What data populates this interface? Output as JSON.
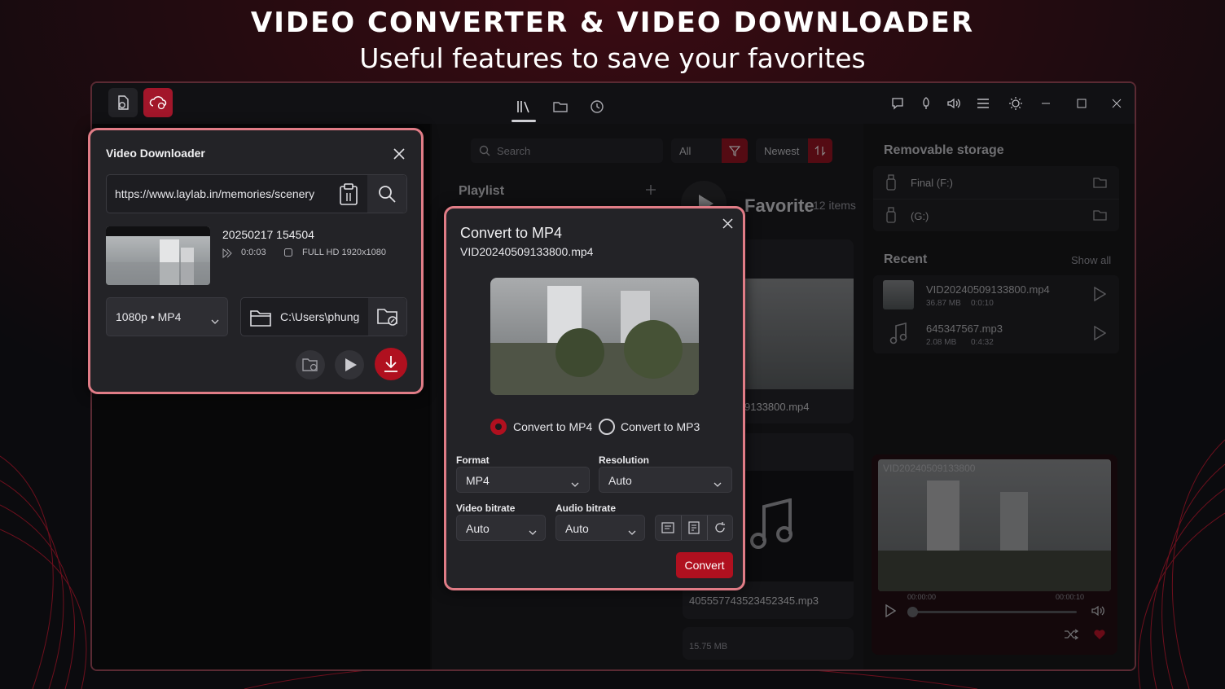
{
  "promo": {
    "title": "VIDEO CONVERTER & VIDEO DOWNLOADER",
    "subtitle": "Useful features to save your favorites"
  },
  "colors": {
    "accent": "#b0101f",
    "highlight_border": "#e07c86",
    "background": "#0b0b0e"
  },
  "titlebar": {
    "left_icons": [
      "file-convert-icon",
      "cloud-download-icon"
    ],
    "tab_icons": [
      "library-icon",
      "folder-icon",
      "history-icon"
    ],
    "right_icons": [
      "chat-icon",
      "rocket-icon",
      "volume-icon",
      "menu-icon",
      "theme-icon",
      "minimize-icon",
      "maximize-icon",
      "close-icon"
    ]
  },
  "library": {
    "search_placeholder": "Search",
    "filter_value": "All",
    "sort_value": "Newest",
    "playlist_label": "Playlist",
    "favorite_title": "Favorite",
    "favorite_count": "12 items",
    "card1_name": "9133800.mp4",
    "card2_name": "405557743523452345.mp3",
    "card3_size": "15.75 MB"
  },
  "sidebar": {
    "removable_title": "Removable storage",
    "drives": [
      {
        "label": "Final (F:)"
      },
      {
        "label": "(G:)"
      }
    ],
    "recent_title": "Recent",
    "show_all": "Show all",
    "recent": [
      {
        "name": "VID20240509133800.mp4",
        "size": "36.87 MB",
        "duration": "0:0:10"
      },
      {
        "name": "645347567.mp3",
        "size": "2.08 MB",
        "duration": "0:4:32"
      }
    ],
    "player": {
      "overlay_title": "VID20240509133800",
      "time_current": "00:00:00",
      "time_total": "00:00:10",
      "progress": 0.0
    }
  },
  "downloader": {
    "title": "Video Downloader",
    "url": "https://www.laylab.in/memories/scenery",
    "video_title": "20250217 154504",
    "duration": "0:0:03",
    "quality": "FULL HD 1920x1080",
    "format_selected": "1080p • MP4",
    "save_path": "C:\\Users\\phung"
  },
  "converter": {
    "title": "Convert to MP4",
    "filename": "VID20240509133800.mp4",
    "radio_mp4": "Convert to MP4",
    "radio_mp3": "Convert to MP3",
    "selected": "mp4",
    "format_label": "Format",
    "format_value": "MP4",
    "resolution_label": "Resolution",
    "resolution_value": "Auto",
    "video_bitrate_label": "Video bitrate",
    "video_bitrate_value": "Auto",
    "audio_bitrate_label": "Audio bitrate",
    "audio_bitrate_value": "Auto",
    "convert_button": "Convert"
  }
}
